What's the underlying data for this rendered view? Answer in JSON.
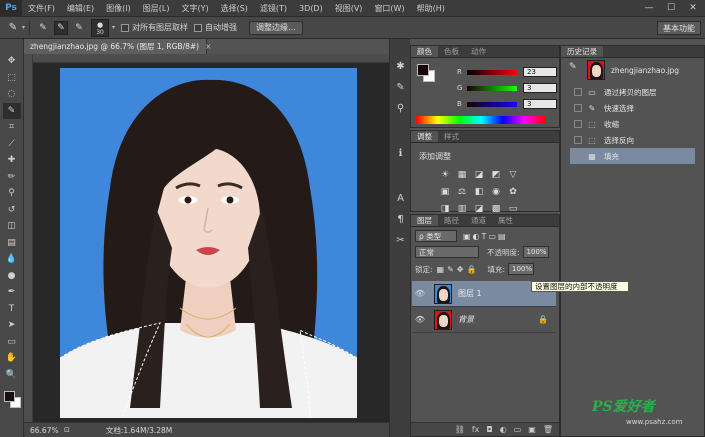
{
  "app": {
    "logo": "Ps"
  },
  "menu": [
    "文件(F)",
    "编辑(E)",
    "图像(I)",
    "图层(L)",
    "文字(Y)",
    "选择(S)",
    "滤镜(T)",
    "3D(D)",
    "视图(V)",
    "窗口(W)",
    "帮助(H)"
  ],
  "window_buttons": [
    "—",
    "☐",
    "✕"
  ],
  "options_bar": {
    "brush_size": "30",
    "sample_all_label": "对所有图层取样",
    "auto_enhance_label": "自动增强",
    "refine_edge_label": "调整边缘...",
    "workspace": "基本功能"
  },
  "document": {
    "tab_title": "zhengjianzhao.jpg @ 66.7% (图层 1, RGB/8#)",
    "close": "×",
    "zoom": "66.67%",
    "doc_info": "文档:1.64M/3.28M"
  },
  "color_panel": {
    "tabs": [
      "颜色",
      "色板",
      "动作"
    ],
    "rows": [
      {
        "label": "R",
        "value": "23"
      },
      {
        "label": "G",
        "value": "3"
      },
      {
        "label": "B",
        "value": "3"
      }
    ]
  },
  "adjust_panel": {
    "tabs": [
      "调整",
      "样式"
    ],
    "title": "添加调整"
  },
  "layers_panel": {
    "tabs": [
      "图层",
      "路径",
      "通道",
      "属性"
    ],
    "kind_filter": "ρ 类型",
    "blend_mode": "正常",
    "opacity_label": "不透明度:",
    "opacity_value": "100%",
    "lock_label": "锁定:",
    "fill_label": "填充:",
    "fill_value": "100%",
    "layers": [
      {
        "name": "图层 1",
        "selected": true
      },
      {
        "name": "背景",
        "selected": false
      }
    ],
    "tooltip": "设置图层的内部不透明度"
  },
  "history_panel": {
    "tab": "历史记录",
    "snapshot": "zhengjianzhao.jpg",
    "items": [
      "通过拷贝的图层",
      "快速选择",
      "收缩",
      "选择反向",
      "填充"
    ]
  },
  "watermark": {
    "logo": "PS爱好者",
    "url": "www.psahz.com"
  },
  "colors": {
    "canvas_bg": "#3f87db",
    "layer_selected": "#7a8aa0",
    "swatch_red": "#d8141c"
  }
}
